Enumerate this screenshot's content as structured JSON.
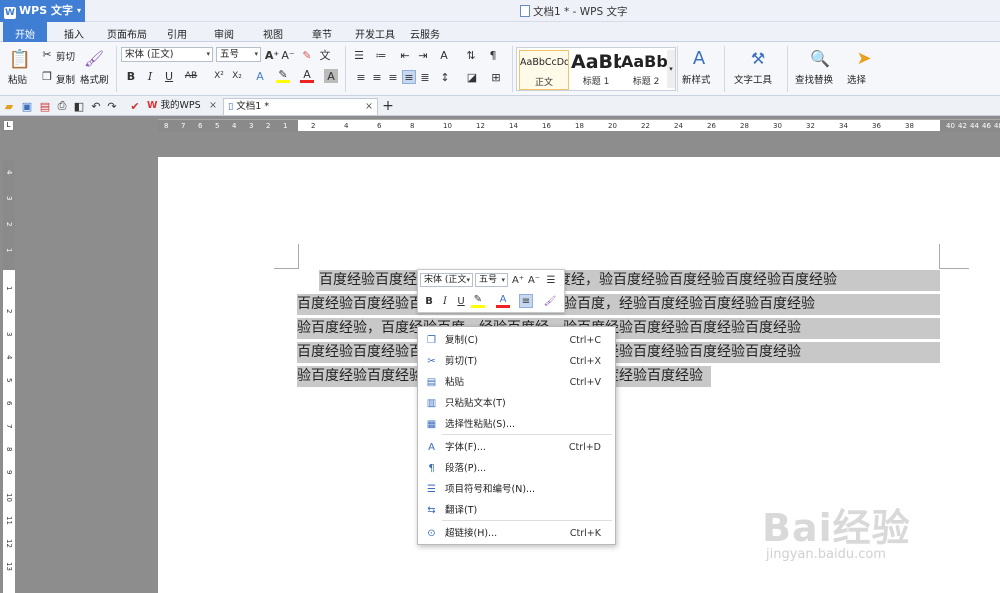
{
  "app": {
    "button_label": "WPS 文字",
    "window_title": "文档1 * - WPS 文字"
  },
  "menu_tabs": [
    "开始",
    "插入",
    "页面布局",
    "引用",
    "审阅",
    "视图",
    "章节",
    "开发工具",
    "云服务"
  ],
  "ribbon": {
    "paste": "粘贴",
    "cut": "剪切",
    "copy": "复制",
    "format_painter": "格式刷",
    "font_name": "宋体 (正文)",
    "font_size": "五号",
    "styles": [
      {
        "preview": "AaBbCcDd",
        "name": "正文"
      },
      {
        "preview": "AaBb",
        "name": "标题 1"
      },
      {
        "preview": "AaBb(",
        "name": "标题 2"
      }
    ],
    "new_style": "新样式",
    "text_tools": "文字工具",
    "find_replace": "查找替换",
    "select": "选择"
  },
  "doc_tabs": {
    "home_tab": "我的WPS",
    "doc_tab": "文档1 *",
    "plus": "+"
  },
  "ruler": {
    "h_dark_left": [
      "8",
      "7",
      "6",
      "5",
      "4",
      "3",
      "2",
      "1"
    ],
    "h_light": [
      "2",
      "4",
      "6",
      "8",
      "10",
      "12",
      "14",
      "16",
      "18",
      "20",
      "22",
      "24",
      "26",
      "28",
      "30",
      "32",
      "34",
      "36",
      "38"
    ],
    "h_dark_right": [
      "40",
      "42",
      "44",
      "46",
      "48"
    ],
    "v_dark": [
      "4",
      "3",
      "2",
      "1"
    ],
    "v_light": [
      "1",
      "2",
      "3",
      "4",
      "5",
      "6",
      "7",
      "8",
      "9",
      "10",
      "11",
      "12",
      "13"
    ]
  },
  "document": {
    "lines": [
      "百度经验百度经验百度经验百度经验百度经，验百度经验百度经验百度经验百度经验",
      "百度经验百度经验百度经验百度经验百度经验百度，经验百度经验百度经验百度经验",
      "验百度经验，百度经验百度，经验百度经，验百度经验百度经验百度经验百度经验",
      "百度经验百度经验百度经验百度经验百度经验百度经验百度经验百度经验百度经验",
      "验百度经验百度经验百度经验百度经验百度经验百度经验百度经验"
    ]
  },
  "mini_toolbar": {
    "font_name": "宋体 (正文",
    "font_size": "五号"
  },
  "context_menu": [
    {
      "icon": "copy-icon",
      "label": "复制(C)",
      "shortcut": "Ctrl+C"
    },
    {
      "icon": "scissors-icon",
      "label": "剪切(T)",
      "shortcut": "Ctrl+X"
    },
    {
      "icon": "paste-icon",
      "label": "粘贴",
      "shortcut": "Ctrl+V"
    },
    {
      "icon": "paste-text-icon",
      "label": "只粘贴文本(T)",
      "shortcut": ""
    },
    {
      "icon": "paste-special-icon",
      "label": "选择性粘贴(S)...",
      "shortcut": ""
    },
    {
      "icon": "font-icon",
      "label": "字体(F)...",
      "shortcut": "Ctrl+D"
    },
    {
      "icon": "paragraph-icon",
      "label": "段落(P)...",
      "shortcut": ""
    },
    {
      "icon": "list-icon",
      "label": "项目符号和编号(N)...",
      "shortcut": ""
    },
    {
      "icon": "translate-icon",
      "label": "翻译(T)",
      "shortcut": ""
    },
    {
      "icon": "hyperlink-icon",
      "label": "超链接(H)...",
      "shortcut": "Ctrl+K"
    }
  ],
  "watermark": {
    "text": "Bai经验",
    "url": "jingyan.baidu.com"
  }
}
